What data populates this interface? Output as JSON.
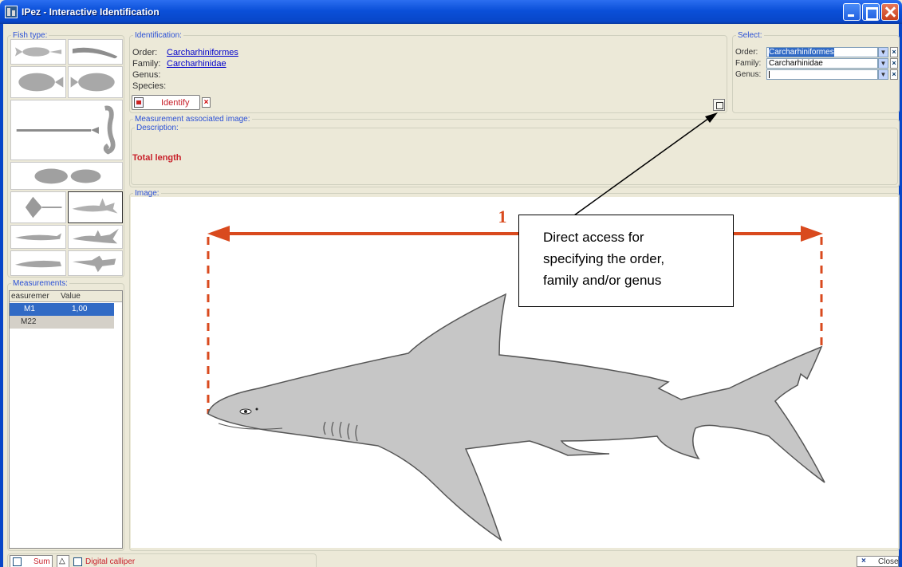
{
  "window": {
    "title": "IPez - Interactive Identification"
  },
  "fish_type": {
    "label": "Fish type:"
  },
  "identification": {
    "label": "Identification:",
    "order_label": "Order:",
    "order_value": "Carcharhiniformes",
    "family_label": "Family:",
    "family_value": "Carcharhinidae",
    "genus_label": "Genus:",
    "species_label": "Species:",
    "identify_label": "Identify"
  },
  "select": {
    "label": "Select:",
    "order_label": "Order:",
    "order_value": "Carcharhiniformes",
    "family_label": "Family:",
    "family_value": "Carcharhinidae",
    "genus_label": "Genus:",
    "genus_value": ""
  },
  "measurement_image": {
    "label": "Measurement associated image:",
    "description_label": "Description:",
    "description_text": "Total length"
  },
  "measurements": {
    "label": "Measurements:",
    "columns": [
      "easuremer",
      "Value"
    ],
    "rows": [
      {
        "name": "M1",
        "value": "1,00",
        "selected": true
      },
      {
        "name": "M22",
        "value": "",
        "selected": false
      }
    ]
  },
  "image": {
    "label": "Image:",
    "marker_number": "1"
  },
  "callout": {
    "line1": "Direct access for",
    "line2": "specifying the order,",
    "line3": "family and/or genus"
  },
  "status_bar": {
    "sum_label": "Sum",
    "calliper_label": "Digital calliper",
    "close_label": "Close"
  },
  "colors": {
    "accent_red": "#d94a1e",
    "link_blue": "#0000cc",
    "selection_blue": "#316ac5",
    "shark_fill": "#c6c6c6"
  }
}
